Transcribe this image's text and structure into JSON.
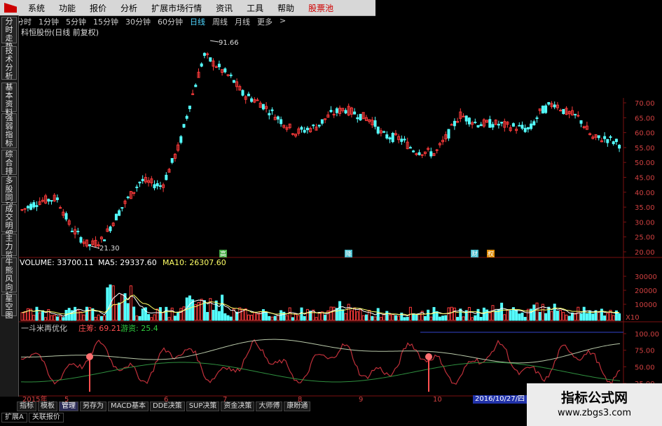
{
  "menu": {
    "items": [
      "系统",
      "功能",
      "报价",
      "分析",
      "扩展市场行情",
      "资讯",
      "工具",
      "帮助"
    ],
    "highlight": "股票池"
  },
  "timeframes": [
    "分时",
    "1分钟",
    "5分钟",
    "15分钟",
    "30分钟",
    "60分钟",
    "日线",
    "周线",
    "月线",
    "更多",
    ">"
  ],
  "active_timeframe": "日线",
  "sidebar": {
    "tabs": [
      "分时走势",
      "技术分析",
      "基本资料",
      "强弱指标",
      "综合排名",
      "多股同列",
      "成交明细",
      "主力监控",
      "牛熊风向标",
      "星空图",
      "资金博弈"
    ]
  },
  "stock_title": "科恒股份(日线 前复权)",
  "price_axis": {
    "ticks": [
      "70.00",
      "65.00",
      "60.00",
      "55.00",
      "50.00",
      "45.00",
      "40.00",
      "35.00",
      "30.00",
      "25.00",
      "20.00"
    ]
  },
  "price_labels": {
    "high": "91.66",
    "low": "21.30"
  },
  "markers": [
    {
      "text": "高",
      "color": "#44aa44"
    },
    {
      "text": "降",
      "color": "#44bbcc"
    },
    {
      "text": "财",
      "color": "#44bbcc"
    },
    {
      "text": "权",
      "color": "#dd8800"
    }
  ],
  "volume": {
    "label": "VOLUME: 33700.11",
    "ma5": "MA5: 29337.60",
    "ma10": "MA10: 26307.60",
    "ticks": [
      "30000",
      "20000",
      "10000"
    ],
    "unit": "X10"
  },
  "indicator": {
    "name": "一斗米再优化",
    "field1": "庄筹: 69.21",
    "field2": "游资: 25.4",
    "ticks": [
      "100.00",
      "75.00",
      "50.00",
      "25.00"
    ]
  },
  "time_axis": [
    "2015年",
    "5",
    "6",
    "7",
    "8",
    "9",
    "10"
  ],
  "date_badge": "2016/10/27/四",
  "bottom_tabs": [
    "指标",
    "模板",
    "管理",
    "另存为",
    "MACD基本",
    "DDE决策",
    "SUP决策",
    "资金决策",
    "大师傅",
    "康盼通"
  ],
  "active_bottom_tab": "管理",
  "bottom_tabs2": [
    "扩展A",
    "关联报价"
  ],
  "watermark": {
    "title": "指标公式网",
    "url": "www.zbgs3.com"
  },
  "colors": {
    "up": "#ff3b3b",
    "down": "#54ffff",
    "ma5": "#ffffff",
    "ma10": "#ffff66",
    "grid": "#7a1010",
    "ind_red": "#c0303a",
    "ind_light": "#b9c9a9",
    "ind_green": "#2f8f3f"
  }
}
